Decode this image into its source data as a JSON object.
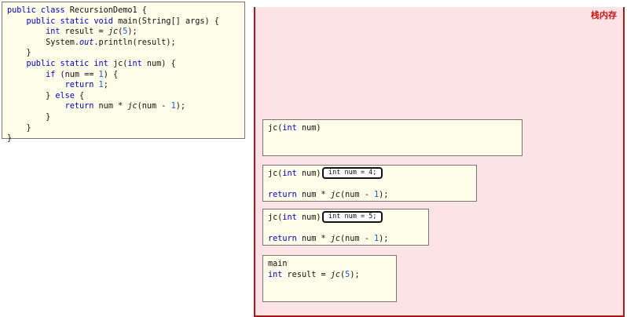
{
  "code": {
    "lines": [
      [
        {
          "t": "public class ",
          "c": "kw"
        },
        {
          "t": "RecursionDemo1 {",
          "c": ""
        }
      ],
      [
        {
          "t": "    public static void ",
          "c": "kw"
        },
        {
          "t": "main(String[] args) {",
          "c": ""
        }
      ],
      [
        {
          "t": "        int ",
          "c": "kw"
        },
        {
          "t": "result = ",
          "c": ""
        },
        {
          "t": "jc",
          "c": "it"
        },
        {
          "t": "(",
          "c": ""
        },
        {
          "t": "5",
          "c": "num"
        },
        {
          "t": ");",
          "c": ""
        }
      ],
      [
        {
          "t": "        System.",
          "c": ""
        },
        {
          "t": "out",
          "c": "st"
        },
        {
          "t": ".println(result);",
          "c": ""
        }
      ],
      [
        {
          "t": "    }",
          "c": ""
        }
      ],
      [
        {
          "t": "    public static int ",
          "c": "kw"
        },
        {
          "t": "jc(",
          "c": ""
        },
        {
          "t": "int ",
          "c": "kw"
        },
        {
          "t": "num) {",
          "c": ""
        }
      ],
      [
        {
          "t": "        if ",
          "c": "kw"
        },
        {
          "t": "(num == ",
          "c": ""
        },
        {
          "t": "1",
          "c": "num"
        },
        {
          "t": ") {",
          "c": ""
        }
      ],
      [
        {
          "t": "            return ",
          "c": "kw"
        },
        {
          "t": "1",
          "c": "num"
        },
        {
          "t": ";",
          "c": ""
        }
      ],
      [
        {
          "t": "        } ",
          "c": ""
        },
        {
          "t": "else ",
          "c": "kw"
        },
        {
          "t": "{",
          "c": ""
        }
      ],
      [
        {
          "t": "            return ",
          "c": "kw"
        },
        {
          "t": "num * ",
          "c": ""
        },
        {
          "t": "jc",
          "c": "it"
        },
        {
          "t": "(num - ",
          "c": ""
        },
        {
          "t": "1",
          "c": "num"
        },
        {
          "t": ");",
          "c": ""
        }
      ],
      [
        {
          "t": "        }",
          "c": ""
        }
      ],
      [
        {
          "t": "    }",
          "c": ""
        }
      ],
      [
        {
          "t": "}",
          "c": ""
        }
      ]
    ]
  },
  "stack": {
    "title": "栈内存",
    "frames": [
      {
        "lines": [
          [
            {
              "t": "jc(",
              "c": ""
            },
            {
              "t": "int ",
              "c": "kw"
            },
            {
              "t": "num)",
              "c": ""
            }
          ]
        ],
        "badge": ""
      },
      {
        "lines": [
          [
            {
              "t": "jc(",
              "c": ""
            },
            {
              "t": "int ",
              "c": "kw"
            },
            {
              "t": "num)",
              "c": ""
            }
          ],
          [],
          [
            {
              "t": "return ",
              "c": "kw"
            },
            {
              "t": "num * ",
              "c": ""
            },
            {
              "t": "jc",
              "c": "it"
            },
            {
              "t": "(num - ",
              "c": ""
            },
            {
              "t": "1",
              "c": "num"
            },
            {
              "t": ");",
              "c": ""
            }
          ]
        ],
        "badge": "int num = 4;"
      },
      {
        "lines": [
          [
            {
              "t": "jc(",
              "c": ""
            },
            {
              "t": "int ",
              "c": "kw"
            },
            {
              "t": "num)",
              "c": ""
            }
          ],
          [],
          [
            {
              "t": "return ",
              "c": "kw"
            },
            {
              "t": "num * ",
              "c": ""
            },
            {
              "t": "jc",
              "c": "it"
            },
            {
              "t": "(num - ",
              "c": ""
            },
            {
              "t": "1",
              "c": "num"
            },
            {
              "t": ");",
              "c": ""
            }
          ]
        ],
        "badge": "int num = 5;"
      },
      {
        "lines": [
          [
            {
              "t": "main",
              "c": ""
            }
          ],
          [
            {
              "t": "int ",
              "c": "kw"
            },
            {
              "t": "result = ",
              "c": ""
            },
            {
              "t": "jc",
              "c": "it"
            },
            {
              "t": "(",
              "c": ""
            },
            {
              "t": "5",
              "c": "num"
            },
            {
              "t": ");",
              "c": ""
            }
          ]
        ],
        "badge": ""
      }
    ]
  }
}
